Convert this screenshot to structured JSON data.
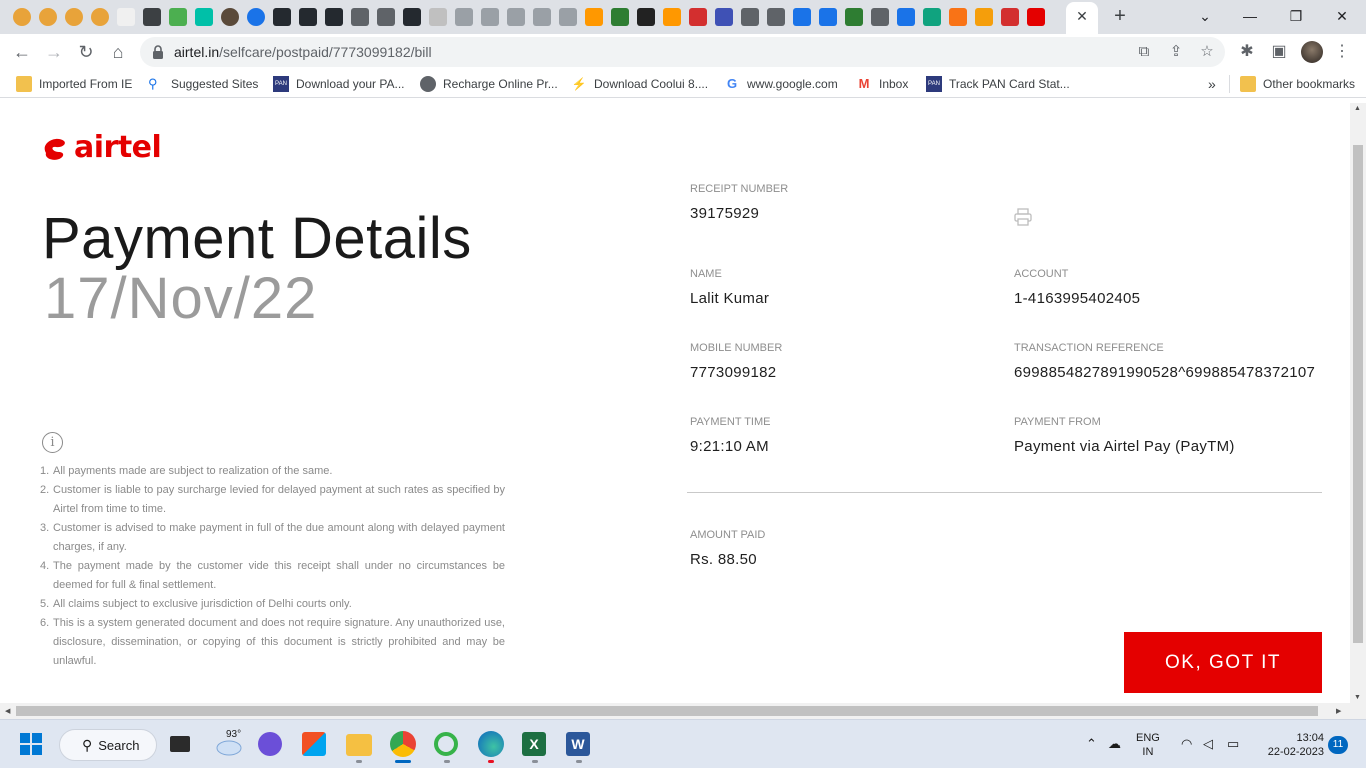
{
  "browser": {
    "url_host": "airtel.in",
    "url_path": "/selfcare/postpaid/7773099182/bill",
    "tab_close_label": "✕",
    "new_tab_label": "+"
  },
  "bookmarks": [
    {
      "label": "Imported From IE",
      "icon": "folder-icon"
    },
    {
      "label": "Suggested Sites",
      "icon": "search-icon"
    },
    {
      "label": "Download your PA...",
      "icon": "pan-icon"
    },
    {
      "label": "Recharge Online Pr...",
      "icon": "globe-icon"
    },
    {
      "label": "Download Coolui 8....",
      "icon": "bolt-icon"
    },
    {
      "label": "www.google.com",
      "icon": "google-icon"
    },
    {
      "label": "Inbox",
      "icon": "gmail-icon"
    },
    {
      "label": "Track PAN Card Stat...",
      "icon": "pan-icon"
    }
  ],
  "bookmarks_more": "»",
  "other_bookmarks": "Other bookmarks",
  "page": {
    "brand": "airtel",
    "title": "Payment Details",
    "date": "17/Nov/22",
    "info_icon": "i",
    "terms": [
      {
        "num": "1.",
        "text": "All payments made are subject to realization of the same."
      },
      {
        "num": "2.",
        "text": "Customer is liable to pay surcharge levied for delayed payment at such rates as specified by Airtel from time to time."
      },
      {
        "num": "3.",
        "text": "Customer is advised to make payment in full of the due amount along with delayed payment charges, if any."
      },
      {
        "num": "4.",
        "text": "The payment made by the customer vide this receipt shall under no circumstances be deemed for full & final settlement."
      },
      {
        "num": "5.",
        "text": "All claims subject to exclusive jurisdiction of Delhi courts only."
      },
      {
        "num": "6.",
        "text": "This is a system generated document and does not require signature. Any unauthorized use, disclosure, dissemination, or copying of this document is strictly prohibited and may be unlawful."
      }
    ],
    "fields": {
      "receipt_number": {
        "label": "RECEIPT NUMBER",
        "value": "39175929"
      },
      "name": {
        "label": "NAME",
        "value": "Lalit Kumar"
      },
      "account": {
        "label": "ACCOUNT",
        "value": "1-4163995402405"
      },
      "mobile_number": {
        "label": "MOBILE NUMBER",
        "value": "7773099182"
      },
      "transaction_reference": {
        "label": "TRANSACTION REFERENCE",
        "value": "699885482789199052​8^699885478372107"
      },
      "payment_time": {
        "label": "PAYMENT TIME",
        "value": "9:21:10 AM"
      },
      "payment_from": {
        "label": "PAYMENT FROM",
        "value": "Payment via Airtel Pay (PayTM)"
      },
      "amount_paid": {
        "label": "AMOUNT PAID",
        "value": "Rs. 88.50"
      }
    },
    "ok_button": "OK, GOT IT"
  },
  "taskbar": {
    "search_label": "Search",
    "weather_temp": "93°",
    "lang_line1": "ENG",
    "lang_line2": "IN",
    "time": "13:04",
    "date": "22-02-2023",
    "notifications": "11"
  },
  "colors": {
    "brand_red": "#e40000",
    "tabstrip": "#dee1e6",
    "taskbar": "#dfe6f1"
  }
}
